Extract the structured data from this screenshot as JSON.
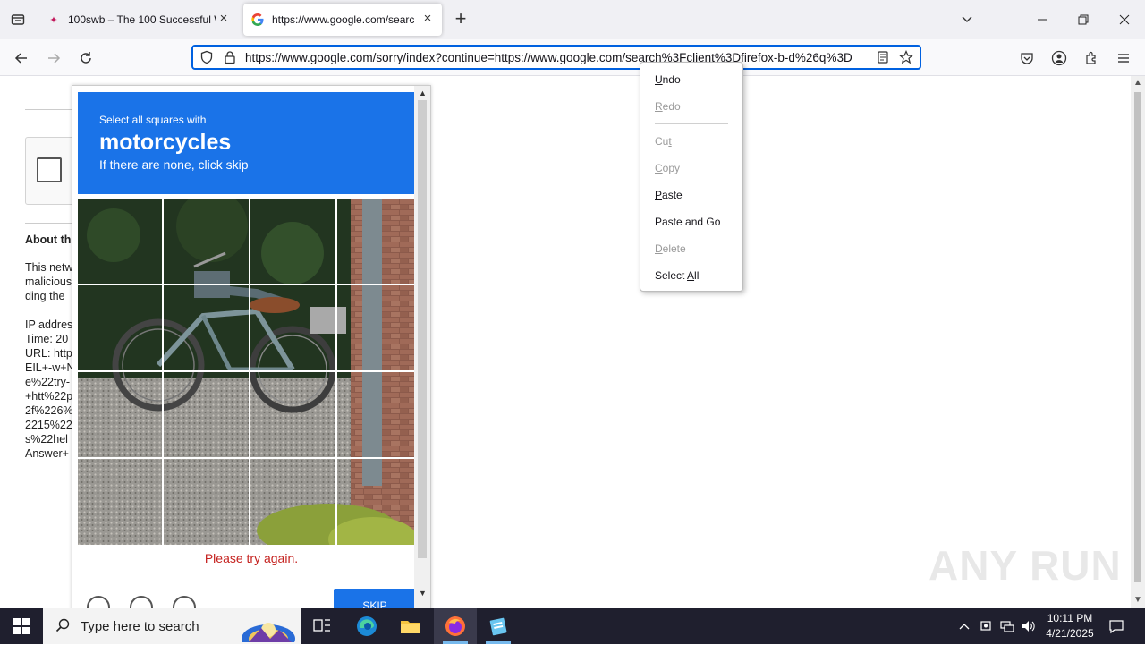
{
  "browser": {
    "tabs": [
      {
        "title": "100swb – The 100 Successful W",
        "favicon": "100swb-icon",
        "active": false
      },
      {
        "title": "https://www.google.com/searc",
        "favicon": "google-icon",
        "active": true
      }
    ],
    "url": "https://www.google.com/sorry/index?continue=https://www.google.com/search%3Fclient%3Dfirefox-b-d%26q%3D"
  },
  "page": {
    "about_heading": "About th",
    "about_lines": [
      "This netw",
      "malicious",
      "ding the"
    ],
    "info_lines": [
      "IP addres",
      "Time: 20",
      "URL: http",
      "EIL+-w+N",
      "e%22try-",
      "+htt%22p",
      "2f%226%",
      "2215%22",
      "s%22hel",
      "Answer+"
    ]
  },
  "captcha": {
    "instruction": "Select all squares with",
    "target": "motorcycles",
    "hint": "If there are none, click skip",
    "error": "Please try again.",
    "verify_label": "SKIP"
  },
  "context_menu": {
    "items": [
      {
        "label": "Undo",
        "access": "U",
        "rest": "ndo",
        "disabled": false
      },
      {
        "label": "Redo",
        "access": "R",
        "rest": "edo",
        "disabled": true
      },
      {
        "separator": true
      },
      {
        "label": "Cut",
        "pre": "Cu",
        "access": "t",
        "rest": "",
        "disabled": true
      },
      {
        "label": "Copy",
        "access": "C",
        "rest": "opy",
        "disabled": true
      },
      {
        "label": "Paste",
        "access": "P",
        "rest": "aste",
        "disabled": false
      },
      {
        "label": "Paste and Go",
        "access": "",
        "rest": "Paste and Go",
        "disabled": false
      },
      {
        "label": "Delete",
        "access": "D",
        "rest": "elete",
        "disabled": true
      },
      {
        "label": "Select All",
        "pre": "Select ",
        "access": "A",
        "rest": "ll",
        "disabled": false
      }
    ]
  },
  "watermark": "ANY RUN",
  "taskbar": {
    "search_placeholder": "Type here to search",
    "time": "10:11 PM",
    "date": "4/21/2025"
  }
}
